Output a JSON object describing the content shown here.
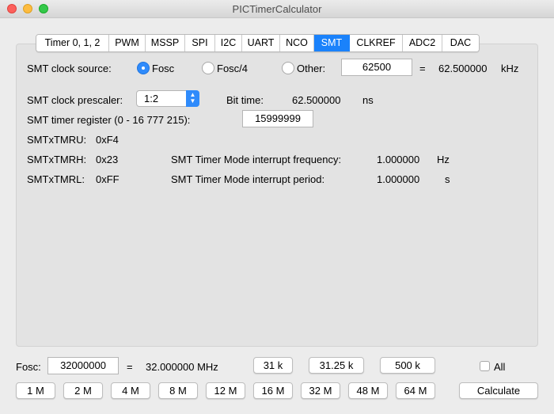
{
  "window": {
    "title": "PICTimerCalculator"
  },
  "tabs": [
    {
      "label": "Timer 0, 1, 2",
      "active": false
    },
    {
      "label": "PWM",
      "active": false
    },
    {
      "label": "MSSP",
      "active": false
    },
    {
      "label": "SPI",
      "active": false
    },
    {
      "label": "I2C",
      "active": false
    },
    {
      "label": "UART",
      "active": false
    },
    {
      "label": "NCO",
      "active": false
    },
    {
      "label": "SMT",
      "active": true
    },
    {
      "label": "CLKREF",
      "active": false
    },
    {
      "label": "ADC2",
      "active": false
    },
    {
      "label": "DAC",
      "active": false
    }
  ],
  "smt": {
    "clock_source_label": "SMT clock source:",
    "options": {
      "fosc": "Fosc",
      "fosc4": "Fosc/4",
      "other": "Other:"
    },
    "selected_option": "Fosc",
    "other_value": "62500",
    "equals": "=",
    "freq_value": "62.500000",
    "freq_unit": "kHz",
    "prescaler_label": "SMT clock prescaler:",
    "prescaler_value": "1:2",
    "bit_time_label": "Bit time:",
    "bit_time_value": "62.500000",
    "bit_time_unit": "ns",
    "timer_register_label": "SMT timer register (0 - 16 777 215):",
    "timer_register_value": "15999999",
    "tmru_label": "SMTxTMRU:",
    "tmru_value": "0xF4",
    "tmrh_label": "SMTxTMRH:",
    "tmrh_value": "0x23",
    "tmrl_label": "SMTxTMRL:",
    "tmrl_value": "0xFF",
    "int_freq_label": "SMT Timer Mode interrupt frequency:",
    "int_freq_value": "1.000000",
    "int_freq_unit": "Hz",
    "int_period_label": "SMT Timer Mode interrupt period:",
    "int_period_value": "1.000000",
    "int_period_unit": "s"
  },
  "bottom": {
    "fosc_label": "Fosc:",
    "fosc_value": "32000000",
    "equals": "=",
    "fosc_display": "32.000000 MHz",
    "quick_row1": [
      "31 k",
      "31.25 k",
      "500 k"
    ],
    "quick_row2": [
      "1 M",
      "2 M",
      "4 M",
      "8 M",
      "12 M",
      "16 M",
      "32 M",
      "48 M",
      "64 M"
    ],
    "all_label": "All",
    "all_checked": false,
    "calculate_label": "Calculate"
  },
  "colors": {
    "accent": "#1a82fb",
    "panel": "#e3e3e3",
    "window": "#ececec"
  }
}
